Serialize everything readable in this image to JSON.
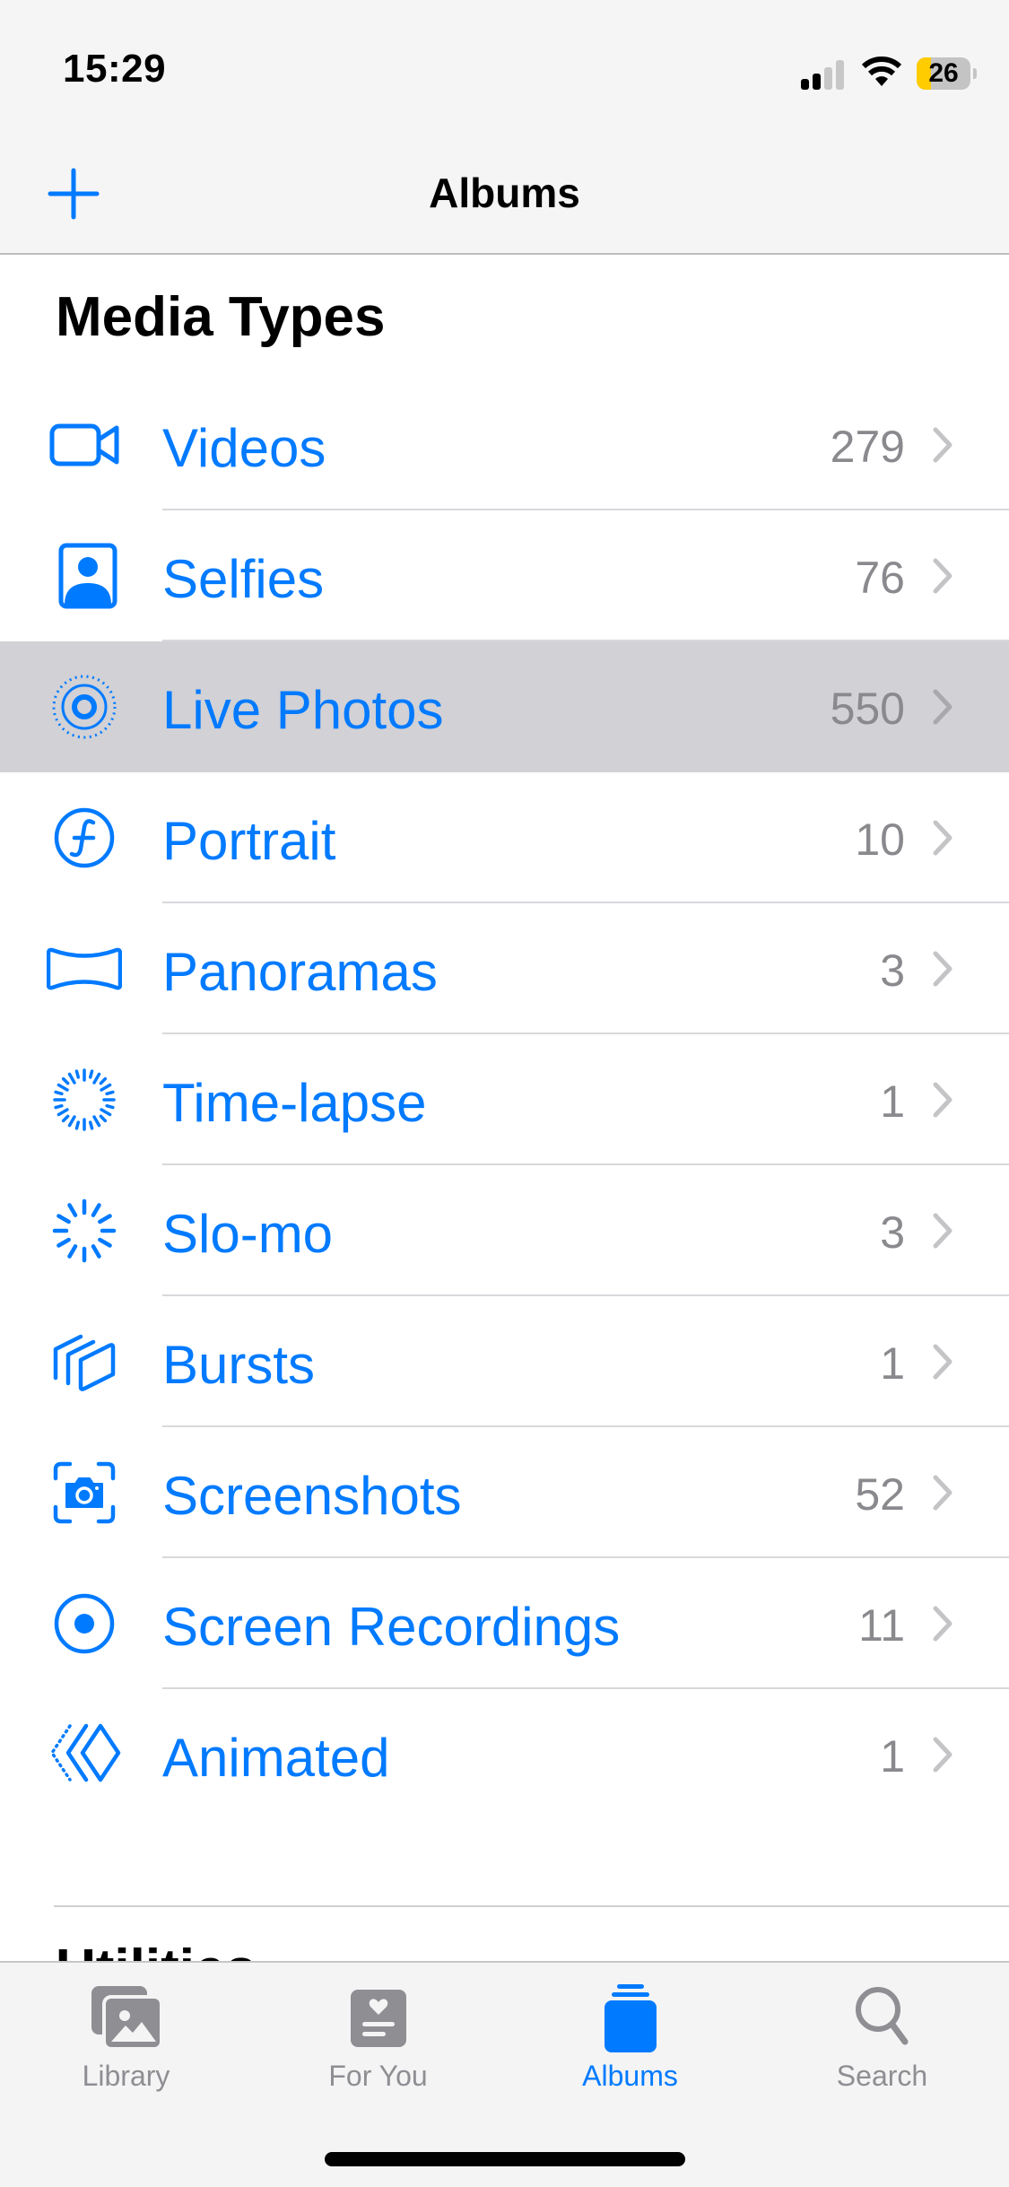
{
  "status_bar": {
    "time": "15:29",
    "signal_bars_active": 2,
    "signal_bars_total": 4,
    "wifi_icon": "wifi-icon",
    "battery_percent": 26,
    "battery_label": "26",
    "battery_color": "#ffcc00"
  },
  "navbar": {
    "title": "Albums",
    "add_icon": "plus-icon"
  },
  "section": {
    "title": "Media Types",
    "items": [
      {
        "label": "Videos",
        "count": "279",
        "icon": "video-camera-icon"
      },
      {
        "label": "Selfies",
        "count": "76",
        "icon": "selfie-portrait-icon"
      },
      {
        "label": "Live Photos",
        "count": "550",
        "icon": "live-photo-icon",
        "highlighted": true
      },
      {
        "label": "Portrait",
        "count": "10",
        "icon": "aperture-f-icon"
      },
      {
        "label": "Panoramas",
        "count": "3",
        "icon": "panorama-icon"
      },
      {
        "label": "Time-lapse",
        "count": "1",
        "icon": "timelapse-icon"
      },
      {
        "label": "Slo-mo",
        "count": "3",
        "icon": "slomo-icon"
      },
      {
        "label": "Bursts",
        "count": "1",
        "icon": "bursts-icon"
      },
      {
        "label": "Screenshots",
        "count": "52",
        "icon": "screenshot-icon"
      },
      {
        "label": "Screen Recordings",
        "count": "11",
        "icon": "screen-recording-icon"
      },
      {
        "label": "Animated",
        "count": "1",
        "icon": "animated-icon"
      }
    ]
  },
  "next_section": {
    "title": "Utilities"
  },
  "tabbar": {
    "tabs": [
      {
        "label": "Library",
        "icon": "photo-library-icon",
        "active": false
      },
      {
        "label": "For You",
        "icon": "for-you-icon",
        "active": false
      },
      {
        "label": "Albums",
        "icon": "albums-stack-icon",
        "active": true
      },
      {
        "label": "Search",
        "icon": "magnifying-glass-icon",
        "active": false
      }
    ]
  },
  "colors": {
    "accent": "#007aff",
    "secondary_text": "#8a8a8e",
    "highlight_row": "#d1d1d6",
    "tab_inactive": "#8e8e93"
  }
}
